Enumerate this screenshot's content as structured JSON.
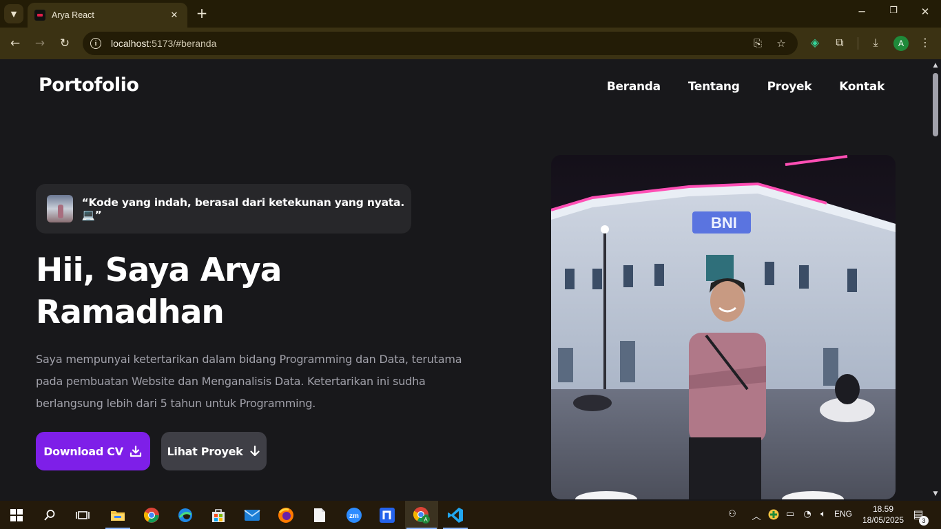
{
  "browser": {
    "tab_title": "Arya React",
    "url_host": "localhost",
    "url_rest": ":5173/#beranda",
    "profile_initial": "A"
  },
  "site": {
    "brand": "Portofolio",
    "nav": [
      "Beranda",
      "Tentang",
      "Proyek",
      "Kontak"
    ],
    "quote": "“Kode yang indah, berasal dari ketekunan yang nyata.💻”",
    "hero_title_line1": "Hii, Saya Arya",
    "hero_title_line2": "Ramadhan",
    "hero_desc": "Saya mempunyai ketertarikan dalam bidang Programming dan Data, terutama pada pembuatan Website dan Menganalisis Data. Ketertarikan ini sudha berlangsung lebih dari 5 tahun untuk Programming.",
    "btn_download": "Download CV",
    "btn_projects": "Lihat Proyek",
    "photo_sign": "BNI"
  },
  "taskbar": {
    "language": "ENG",
    "time": "18.59",
    "date": "18/05/2025",
    "notification_count": "3",
    "zoom_label": "zm"
  },
  "colors": {
    "accent": "#7e1fe8",
    "secondary_button": "#3f3f46",
    "page_bg": "#18181b"
  }
}
